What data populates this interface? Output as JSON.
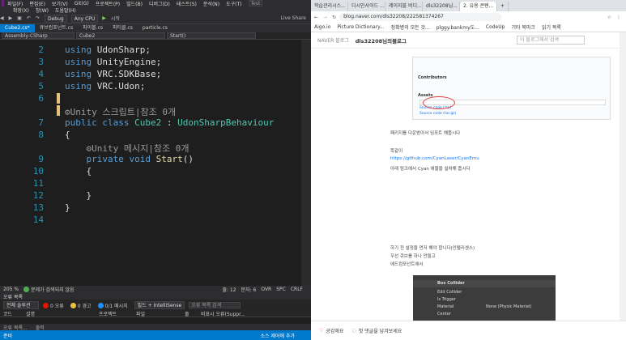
{
  "vs": {
    "menu1": [
      "파일(F)",
      "편집(E)",
      "보기(V)",
      "Git(G)",
      "프로젝트(P)",
      "빌드(B)",
      "디버그(D)",
      "테스트(S)",
      "분석(N)",
      "도구(T)"
    ],
    "menu2": [
      "확장(X)",
      "창(W)",
      "도움말(H)"
    ],
    "search_placeholder": "Test",
    "toolbar": {
      "config": "Debug",
      "platform": "Any CPU",
      "run_label": "시작",
      "live_share": "Live Share"
    },
    "tabs": [
      "Cube2.cs*",
      "큐브컴포넌트.cs",
      "파이볼.cs",
      "파티클.cs",
      "particle.cs"
    ],
    "nav": {
      "project": "Assembly-CSharp",
      "class": "Cube2",
      "member": "Start()"
    },
    "lines": [
      {
        "n": "2",
        "parts": [
          [
            "kw",
            "using"
          ],
          [
            "",
            " UdonSharp;"
          ]
        ]
      },
      {
        "n": "3",
        "parts": [
          [
            "kw",
            "using"
          ],
          [
            "",
            " UnityEngine;"
          ]
        ]
      },
      {
        "n": "4",
        "parts": [
          [
            "kw",
            "using"
          ],
          [
            "",
            " VRC.SDKBase;"
          ]
        ]
      },
      {
        "n": "5",
        "parts": [
          [
            "kw",
            "using"
          ],
          [
            "",
            " VRC.Udon;"
          ]
        ]
      },
      {
        "n": "6",
        "parts": [
          [
            "",
            ""
          ]
        ]
      },
      {
        "n": "",
        "parts": [
          [
            "cl",
            "⚙Unity 스크립트|참조 0개"
          ]
        ]
      },
      {
        "n": "7",
        "parts": [
          [
            "kw",
            "public class"
          ],
          [
            "ty",
            " Cube2"
          ],
          [
            "",
            " : "
          ],
          [
            "ty",
            "UdonSharpBehaviour"
          ]
        ]
      },
      {
        "n": "8",
        "parts": [
          [
            "",
            "{"
          ]
        ]
      },
      {
        "n": "",
        "parts": [
          [
            "cl",
            "    ⚙Unity 메시지|참조 0개"
          ]
        ]
      },
      {
        "n": "9",
        "parts": [
          [
            "kw",
            "    private void"
          ],
          [
            "fn",
            " Start"
          ],
          [
            "",
            "()"
          ]
        ]
      },
      {
        "n": "10",
        "parts": [
          [
            "",
            "    {"
          ]
        ]
      },
      {
        "n": "11",
        "parts": [
          [
            "",
            ""
          ]
        ]
      },
      {
        "n": "12",
        "parts": [
          [
            "",
            "    }"
          ]
        ]
      },
      {
        "n": "13",
        "parts": [
          [
            "",
            "}"
          ]
        ]
      },
      {
        "n": "14",
        "parts": [
          [
            "",
            ""
          ]
        ]
      }
    ],
    "status1": {
      "zoom": "205 %",
      "issues": "문제가 검색되지 않음",
      "line": "줄: 12",
      "col": "문자: 6",
      "ins": "OVR",
      "tab": "SPC",
      "eol": "CRLF"
    },
    "error_list_title": "오류 목록",
    "error_bar": {
      "scope": "전체 솔루션",
      "errors": "0 오류",
      "warnings": "0 경고",
      "messages": "0/1 메시지",
      "build": "빌드 + IntelliSense",
      "search": "오류 목록 검색"
    },
    "error_cols": [
      "코드",
      "설명",
      "프로젝트",
      "파일",
      "줄",
      "비표시 오류(Suppr..."
    ],
    "bottom_tabs": [
      "오류 목록...",
      "출력"
    ],
    "statusbar": {
      "left": "준비",
      "right": "소스 제어에 추가"
    }
  },
  "browser": {
    "tabs": [
      "학습관리시스...",
      "디시인사이드 ...",
      "레이지블 비디...",
      "dls32208님...",
      "2. 유용 콘텐...",
      "+"
    ],
    "url": "blog.naver.com/dls32208/222581374267",
    "bookmarks": [
      "Aigo.io",
      "Picture Dictionary...",
      "정확병의 모든 것...",
      "plggy.bankmy도...",
      "CodeUp",
      "기타 북마크",
      "읽기 목록"
    ],
    "blog_nav": {
      "brand": "NAVER 블로그",
      "name": "dls32208님의블로그",
      "search": "이 블로그에서 검색"
    },
    "shot_lines": [
      "Contributors",
      "Assets",
      "Source code (zip)",
      "Source code (tar.gz)"
    ],
    "para1": "패키지를 다운받아서 임포트 해줍시다",
    "para2": "똑같이",
    "link": "https://github.com/CyanLaser/CyanEmu",
    "para3": "아래 링크에서 Cyan 애뮬을 설치해 줍시다",
    "para4": "하기 전 설정을 먼저 해야 합니다(인텔리센스)",
    "para5": "우선 큐브를 하나 만들고",
    "para6": "에드컴포넌트에서",
    "unity": {
      "title": "Box Collider",
      "rows": [
        "Edit Collider",
        "Is Trigger",
        "Material",
        "Center"
      ],
      "material_val": "None (Physic Material)"
    },
    "footer": {
      "like": "공감해요",
      "comment": "첫 댓글을 남겨보세요"
    }
  }
}
